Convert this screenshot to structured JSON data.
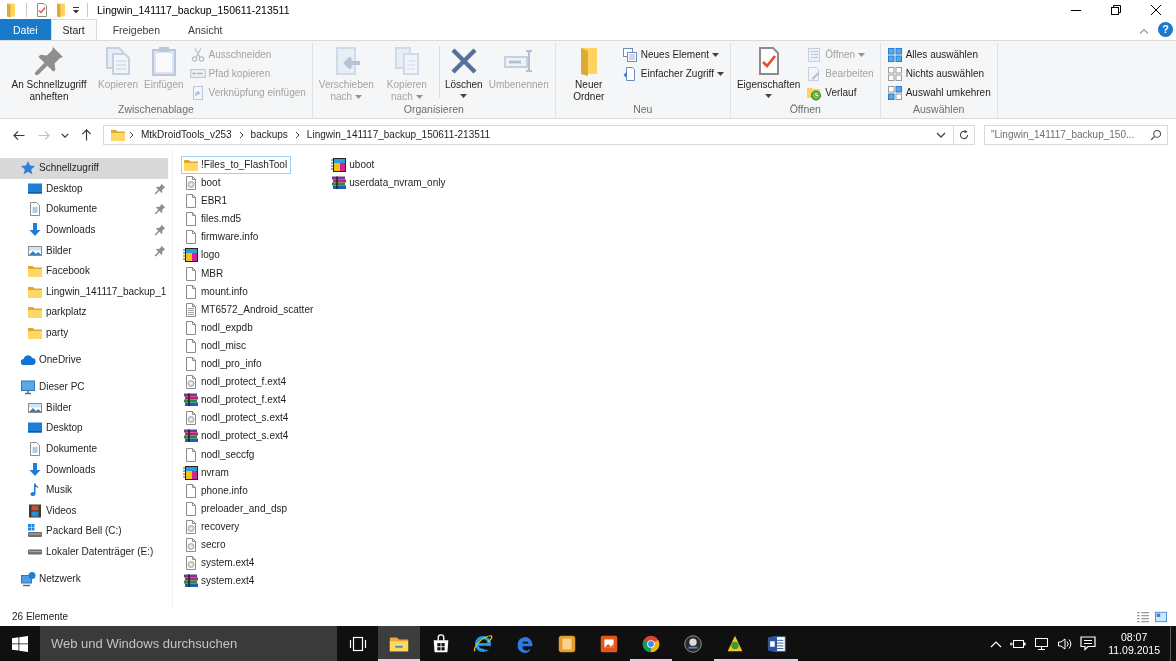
{
  "window": {
    "title": "Lingwin_141117_backup_150611-213511",
    "help": "?"
  },
  "ribbon_tabs": [
    {
      "label": "Datei",
      "kind": "file",
      "selected": false
    },
    {
      "label": "Start",
      "kind": "tab",
      "selected": true
    },
    {
      "label": "Freigeben",
      "kind": "tab",
      "selected": false
    },
    {
      "label": "Ansicht",
      "kind": "tab",
      "selected": false
    }
  ],
  "ribbon_groups": [
    {
      "label": "Zwischenablage",
      "items": [
        {
          "kind": "large",
          "label": "An Schnellzugriff anheften",
          "disabled": false,
          "dropdown": false
        },
        {
          "kind": "large",
          "label": "Kopieren",
          "disabled": true,
          "dropdown": false
        },
        {
          "kind": "large",
          "label": "Einfügen",
          "disabled": true,
          "dropdown": false
        },
        {
          "kind": "stack",
          "buttons": [
            {
              "label": "Ausschneiden",
              "disabled": true,
              "dropdown": false
            },
            {
              "label": "Pfad kopieren",
              "disabled": true,
              "dropdown": false
            },
            {
              "label": "Verknüpfung einfügen",
              "disabled": true,
              "dropdown": false
            }
          ]
        }
      ]
    },
    {
      "label": "Organisieren",
      "items": [
        {
          "kind": "large",
          "label": "Verschieben nach",
          "disabled": true,
          "dropdown": true,
          "divider_before": false
        },
        {
          "kind": "large",
          "label": "Kopieren nach",
          "disabled": true,
          "dropdown": true,
          "divider_before": false
        },
        {
          "kind": "large",
          "label": "Löschen",
          "disabled": false,
          "dropdown": true,
          "divider_before": true
        },
        {
          "kind": "large",
          "label": "Umbenennen",
          "disabled": true,
          "dropdown": false,
          "divider_before": false
        }
      ]
    },
    {
      "label": "Neu",
      "items": [
        {
          "kind": "large",
          "label": "Neuer Ordner",
          "disabled": false,
          "dropdown": false
        },
        {
          "kind": "stack",
          "buttons": [
            {
              "label": "Neues Element",
              "disabled": false,
              "dropdown": true
            },
            {
              "label": "Einfacher Zugriff",
              "disabled": false,
              "dropdown": true
            }
          ]
        }
      ]
    },
    {
      "label": "Öffnen",
      "items": [
        {
          "kind": "large",
          "label": "Eigenschaften",
          "disabled": false,
          "dropdown": true
        },
        {
          "kind": "stack",
          "buttons": [
            {
              "label": "Öffnen",
              "disabled": true,
              "dropdown": true
            },
            {
              "label": "Bearbeiten",
              "disabled": true,
              "dropdown": false
            },
            {
              "label": "Verlauf",
              "disabled": false,
              "dropdown": false
            }
          ]
        }
      ]
    },
    {
      "label": "Auswählen",
      "items": [
        {
          "kind": "stack",
          "buttons": [
            {
              "label": "Alles auswählen",
              "disabled": false,
              "dropdown": false
            },
            {
              "label": "Nichts auswählen",
              "disabled": false,
              "dropdown": false
            },
            {
              "label": "Auswahl umkehren",
              "disabled": false,
              "dropdown": false
            }
          ]
        }
      ]
    }
  ],
  "nav_buttons": [
    {
      "kind": "back",
      "disabled": false
    },
    {
      "kind": "forward",
      "disabled": true
    },
    {
      "kind": "recent",
      "disabled": false
    },
    {
      "kind": "up",
      "disabled": false
    }
  ],
  "address": {
    "path": [
      "MtkDroidTools_v253",
      "backups",
      "Lingwin_141117_backup_150611-213511"
    ]
  },
  "search": {
    "placeholder": "\"Lingwin_141117_backup_150..."
  },
  "sidebar": {
    "items": [
      {
        "label": "Schnellzugriff",
        "kind": "quick-access",
        "selected": true,
        "pinned": false,
        "children": [
          {
            "label": "Desktop",
            "kind": "desktop",
            "selected": false,
            "pinned": true
          },
          {
            "label": "Dokumente",
            "kind": "documents",
            "selected": false,
            "pinned": true
          },
          {
            "label": "Downloads",
            "kind": "downloads",
            "selected": false,
            "pinned": true
          },
          {
            "label": "Bilder",
            "kind": "pictures",
            "selected": false,
            "pinned": true
          },
          {
            "label": "Facebook",
            "kind": "folder",
            "selected": false,
            "pinned": false
          },
          {
            "label": "Lingwin_141117_backup_1",
            "kind": "folder",
            "selected": false,
            "pinned": false
          },
          {
            "label": "parkplatz",
            "kind": "folder",
            "selected": false,
            "pinned": false
          },
          {
            "label": "party",
            "kind": "folder",
            "selected": false,
            "pinned": false
          }
        ]
      },
      {
        "label": "OneDrive",
        "kind": "cloud",
        "selected": false,
        "pinned": false
      },
      {
        "label": "Dieser PC",
        "kind": "pc",
        "selected": false,
        "pinned": false,
        "children": [
          {
            "label": "Bilder",
            "kind": "pictures",
            "selected": false,
            "pinned": false
          },
          {
            "label": "Desktop",
            "kind": "desktop",
            "selected": false,
            "pinned": false
          },
          {
            "label": "Dokumente",
            "kind": "documents",
            "selected": false,
            "pinned": false
          },
          {
            "label": "Downloads",
            "kind": "downloads",
            "selected": false,
            "pinned": false
          },
          {
            "label": "Musik",
            "kind": "music",
            "selected": false,
            "pinned": false
          },
          {
            "label": "Videos",
            "kind": "videos",
            "selected": false,
            "pinned": false
          },
          {
            "label": "Packard Bell (C:)",
            "kind": "system-drive",
            "selected": false,
            "pinned": false
          },
          {
            "label": "Lokaler Datenträger (E:)",
            "kind": "drive",
            "selected": false,
            "pinned": false
          }
        ]
      },
      {
        "label": "Netzwerk",
        "kind": "network",
        "selected": false,
        "pinned": false
      }
    ]
  },
  "files": [
    {
      "name": "!Files_to_FlashTool",
      "kind": "folder",
      "focused": true
    },
    {
      "name": "boot",
      "kind": "image",
      "focused": false
    },
    {
      "name": "EBR1",
      "kind": "blank",
      "focused": false
    },
    {
      "name": "files.md5",
      "kind": "blank",
      "focused": false
    },
    {
      "name": "firmware.info",
      "kind": "blank",
      "focused": false
    },
    {
      "name": "logo",
      "kind": "app",
      "focused": false
    },
    {
      "name": "MBR",
      "kind": "blank",
      "focused": false
    },
    {
      "name": "mount.info",
      "kind": "blank",
      "focused": false
    },
    {
      "name": "MT6572_Android_scatter",
      "kind": "text",
      "focused": false
    },
    {
      "name": "nodl_expdb",
      "kind": "blank",
      "focused": false
    },
    {
      "name": "nodl_misc",
      "kind": "blank",
      "focused": false
    },
    {
      "name": "nodl_pro_info",
      "kind": "blank",
      "focused": false
    },
    {
      "name": "nodl_protect_f.ext4",
      "kind": "image",
      "focused": false
    },
    {
      "name": "nodl_protect_f.ext4",
      "kind": "archive",
      "focused": false
    },
    {
      "name": "nodl_protect_s.ext4",
      "kind": "image",
      "focused": false
    },
    {
      "name": "nodl_protect_s.ext4",
      "kind": "archive",
      "focused": false
    },
    {
      "name": "nodl_seccfg",
      "kind": "blank",
      "focused": false
    },
    {
      "name": "nvram",
      "kind": "app",
      "focused": false
    },
    {
      "name": "phone.info",
      "kind": "blank",
      "focused": false
    },
    {
      "name": "preloader_and_dsp",
      "kind": "blank",
      "focused": false
    },
    {
      "name": "recovery",
      "kind": "image",
      "focused": false
    },
    {
      "name": "secro",
      "kind": "image",
      "focused": false
    },
    {
      "name": "system.ext4",
      "kind": "image",
      "focused": false
    },
    {
      "name": "system.ext4",
      "kind": "archive",
      "focused": false
    },
    {
      "name": "uboot",
      "kind": "app",
      "focused": false
    },
    {
      "name": "userdata_nvram_only",
      "kind": "archive",
      "focused": false
    }
  ],
  "status_bar": {
    "count": "26 Elemente"
  },
  "taskbar": {
    "search": {
      "placeholder": "Web und Windows durchsuchen"
    },
    "apps": [
      {
        "active": true,
        "running": true
      },
      {
        "active": false,
        "running": false
      },
      {
        "active": false,
        "running": false
      },
      {
        "active": false,
        "running": false
      },
      {
        "active": false,
        "running": false
      },
      {
        "active": false,
        "running": false
      },
      {
        "active": false,
        "running": true
      },
      {
        "active": false,
        "running": false
      },
      {
        "active": false,
        "running": true
      },
      {
        "active": false,
        "running": true
      }
    ],
    "clock": {
      "time": "08:07",
      "date": "11.09.2015"
    }
  }
}
